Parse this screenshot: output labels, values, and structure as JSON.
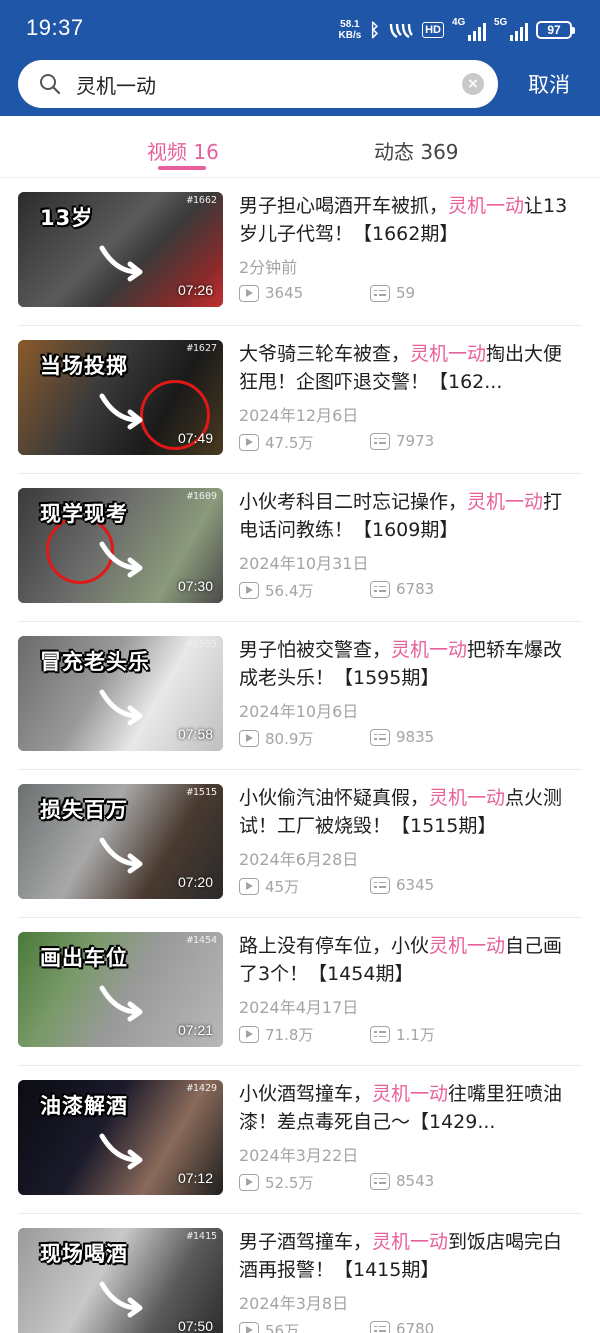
{
  "status_bar": {
    "time": "19:37",
    "net_speed_value": "58.1",
    "net_speed_unit": "KB/s",
    "hd_label": "HD",
    "signal1_label": "4G",
    "signal2_label": "5G",
    "battery": "97"
  },
  "search": {
    "query": "灵机一动",
    "cancel_label": "取消"
  },
  "tabs": [
    {
      "label": "视频 16",
      "active": true
    },
    {
      "label": "动态 369",
      "active": false
    }
  ],
  "colors": {
    "header": "#1f56a8",
    "accent": "#e8609a",
    "meta": "#a4a4a4"
  },
  "videos": [
    {
      "caption": "13岁",
      "issue": "#1662",
      "duration": "07:26",
      "title_pre": "男子担心喝酒开车被抓，",
      "title_hl": "灵机一动",
      "title_post": "让13岁儿子代驾！【1662期】",
      "date": "2分钟前",
      "plays": "3645",
      "comments": "59"
    },
    {
      "caption": "当场投掷",
      "issue": "#1627",
      "duration": "07:49",
      "title_pre": "大爷骑三轮车被查，",
      "title_hl": "灵机一动",
      "title_post": "掏出大便狂甩！企图吓退交警！【162...",
      "date": "2024年12月6日",
      "plays": "47.5万",
      "comments": "7973"
    },
    {
      "caption": "现学现考",
      "issue": "#1609",
      "duration": "07:30",
      "title_pre": "小伙考科目二时忘记操作，",
      "title_hl": "灵机一动",
      "title_post": "打电话问教练！【1609期】",
      "date": "2024年10月31日",
      "plays": "56.4万",
      "comments": "6783"
    },
    {
      "caption": "冒充老头乐",
      "issue": "#1595",
      "duration": "07:58",
      "title_pre": "男子怕被交警查，",
      "title_hl": "灵机一动",
      "title_post": "把轿车爆改成老头乐！【1595期】",
      "date": "2024年10月6日",
      "plays": "80.9万",
      "comments": "9835"
    },
    {
      "caption": "损失百万",
      "issue": "#1515",
      "duration": "07:20",
      "title_pre": "小伙偷汽油怀疑真假，",
      "title_hl": "灵机一动",
      "title_post": "点火测试！工厂被烧毁！【1515期】",
      "date": "2024年6月28日",
      "plays": "45万",
      "comments": "6345"
    },
    {
      "caption": "画出车位",
      "issue": "#1454",
      "duration": "07:21",
      "title_pre": "路上没有停车位，小伙",
      "title_hl": "灵机一动",
      "title_post": "自己画了3个！【1454期】",
      "date": "2024年4月17日",
      "plays": "71.8万",
      "comments": "1.1万"
    },
    {
      "caption": "油漆解酒",
      "issue": "#1429",
      "duration": "07:12",
      "title_pre": "小伙酒驾撞车，",
      "title_hl": "灵机一动",
      "title_post": "往嘴里狂喷油漆！差点毒死自己～【1429...",
      "date": "2024年3月22日",
      "plays": "52.5万",
      "comments": "8543"
    },
    {
      "caption": "现场喝酒",
      "issue": "#1415",
      "duration": "07:50",
      "title_pre": "男子酒驾撞车，",
      "title_hl": "灵机一动",
      "title_post": "到饭店喝完白酒再报警！【1415期】",
      "date": "2024年3月8日",
      "plays": "56万",
      "comments": "6780"
    }
  ]
}
